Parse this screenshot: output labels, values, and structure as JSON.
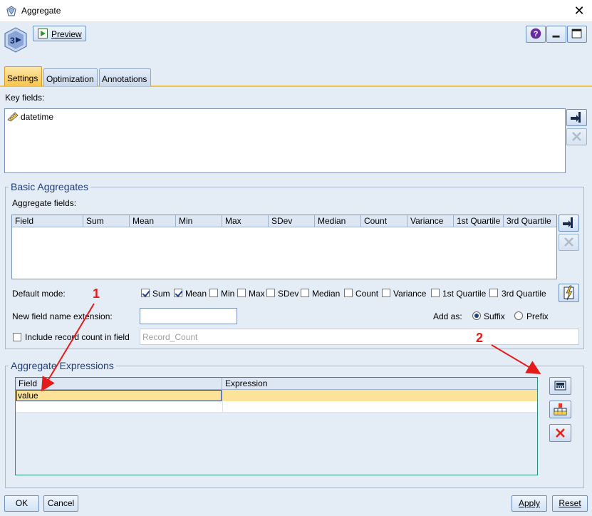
{
  "window": {
    "title": "Aggregate"
  },
  "toolbar": {
    "preview_label": "Preview"
  },
  "tabs": [
    {
      "label": "Settings",
      "active": true
    },
    {
      "label": "Optimization",
      "active": false
    },
    {
      "label": "Annotations",
      "active": false
    }
  ],
  "key_fields": {
    "label": "Key fields:",
    "items": [
      {
        "name": "datetime",
        "icon": "timestamp-ruler-icon"
      }
    ]
  },
  "basic_aggregates": {
    "title": "Basic Aggregates",
    "aggregate_fields_label": "Aggregate fields:",
    "columns": [
      "Field",
      "Sum",
      "Mean",
      "Min",
      "Max",
      "SDev",
      "Median",
      "Count",
      "Variance",
      "1st Quartile",
      "3rd Quartile"
    ],
    "default_mode_label": "Default mode:",
    "modes": [
      {
        "label": "Sum",
        "checked": true
      },
      {
        "label": "Mean",
        "checked": true
      },
      {
        "label": "Min",
        "checked": false
      },
      {
        "label": "Max",
        "checked": false
      },
      {
        "label": "SDev",
        "checked": false
      },
      {
        "label": "Median",
        "checked": false
      },
      {
        "label": "Count",
        "checked": false
      },
      {
        "label": "Variance",
        "checked": false
      },
      {
        "label": "1st Quartile",
        "checked": false
      },
      {
        "label": "3rd Quartile",
        "checked": false
      }
    ],
    "new_field_ext_label": "New field name extension:",
    "new_field_ext_value": "",
    "add_as_label": "Add as:",
    "add_as_options": [
      {
        "label": "Suffix",
        "selected": true
      },
      {
        "label": "Prefix",
        "selected": false
      }
    ],
    "include_count_label": "Include record count in field",
    "include_count_checked": false,
    "record_count_placeholder": "Record_Count"
  },
  "aggregate_expressions": {
    "title": "Aggregate Expressions",
    "columns": [
      "Field",
      "Expression"
    ],
    "rows": [
      {
        "field": "value",
        "expression": ""
      }
    ]
  },
  "annotations": {
    "marker1": "1",
    "marker2": "2"
  },
  "buttons": {
    "ok": "OK",
    "cancel": "Cancel",
    "apply": "Apply",
    "reset": "Reset"
  },
  "colors": {
    "accent_tab": "#f8c44f",
    "selected_row": "#fde39a",
    "annotation": "#e31b1b",
    "legend_text": "#1f3f7a"
  }
}
